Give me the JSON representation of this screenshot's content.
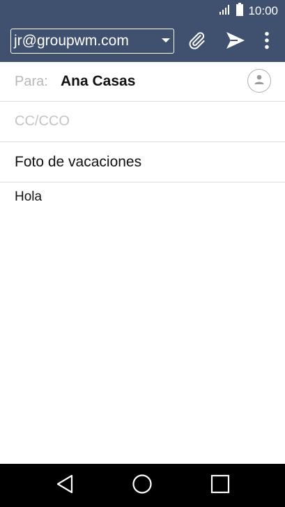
{
  "status_bar": {
    "time": "10:00",
    "icons": [
      "signal-icon",
      "battery-icon"
    ]
  },
  "toolbar": {
    "account": "jr@groupwm.com",
    "icons": [
      "dropdown-caret-icon",
      "attach-icon",
      "send-icon",
      "more-vert-icon"
    ],
    "color": "#40516f"
  },
  "compose": {
    "to_label": "Para:",
    "to_value": "Ana Casas",
    "cc_placeholder": "CC/CCO",
    "subject": "Foto de vacaciones",
    "body": "Hola"
  },
  "nav_bar": {
    "icons": [
      "back-icon",
      "home-icon",
      "recents-icon"
    ]
  }
}
